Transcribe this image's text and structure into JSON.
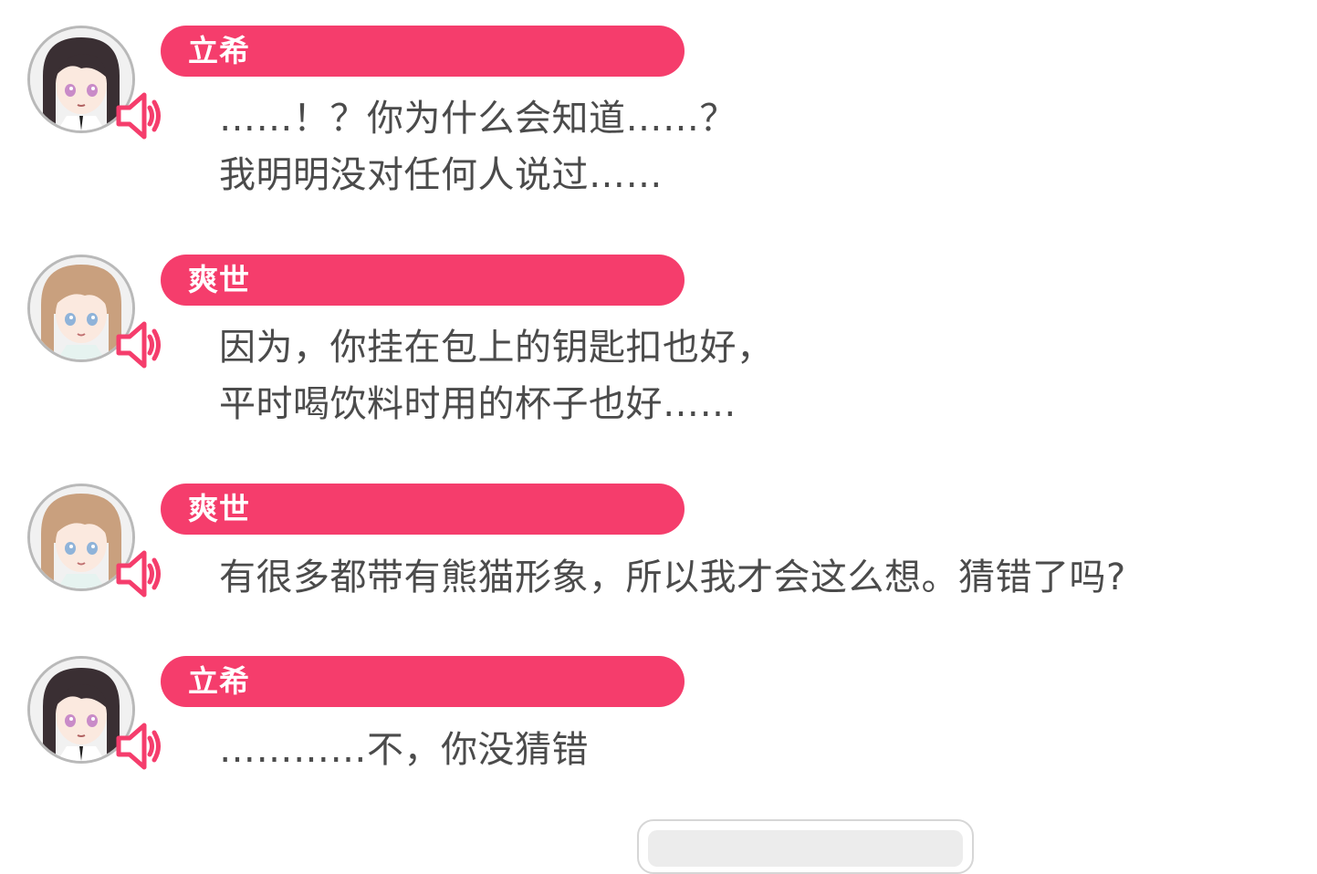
{
  "messages": [
    {
      "speaker": "立希",
      "avatar_icon": "rikki-avatar",
      "lines": [
        "……！？你为什么会知道……？",
        "我明明没对任何人说过……"
      ]
    },
    {
      "speaker": "爽世",
      "avatar_icon": "soyo-avatar",
      "lines": [
        "因为，你挂在包上的钥匙扣也好，",
        "平时喝饮料时用的杯子也好……"
      ]
    },
    {
      "speaker": "爽世",
      "avatar_icon": "soyo-avatar",
      "lines": [
        "有很多都带有熊猫形象，所以我才会这么想。猜错了吗?"
      ]
    },
    {
      "speaker": "立希",
      "avatar_icon": "rikki-avatar",
      "lines": [
        "…………不，你没猜错"
      ]
    }
  ],
  "colors": {
    "accent": "#f53d6c",
    "text": "#4b4b4b",
    "background": "#ffffff"
  },
  "icons": {
    "voice": "speaker-icon"
  }
}
